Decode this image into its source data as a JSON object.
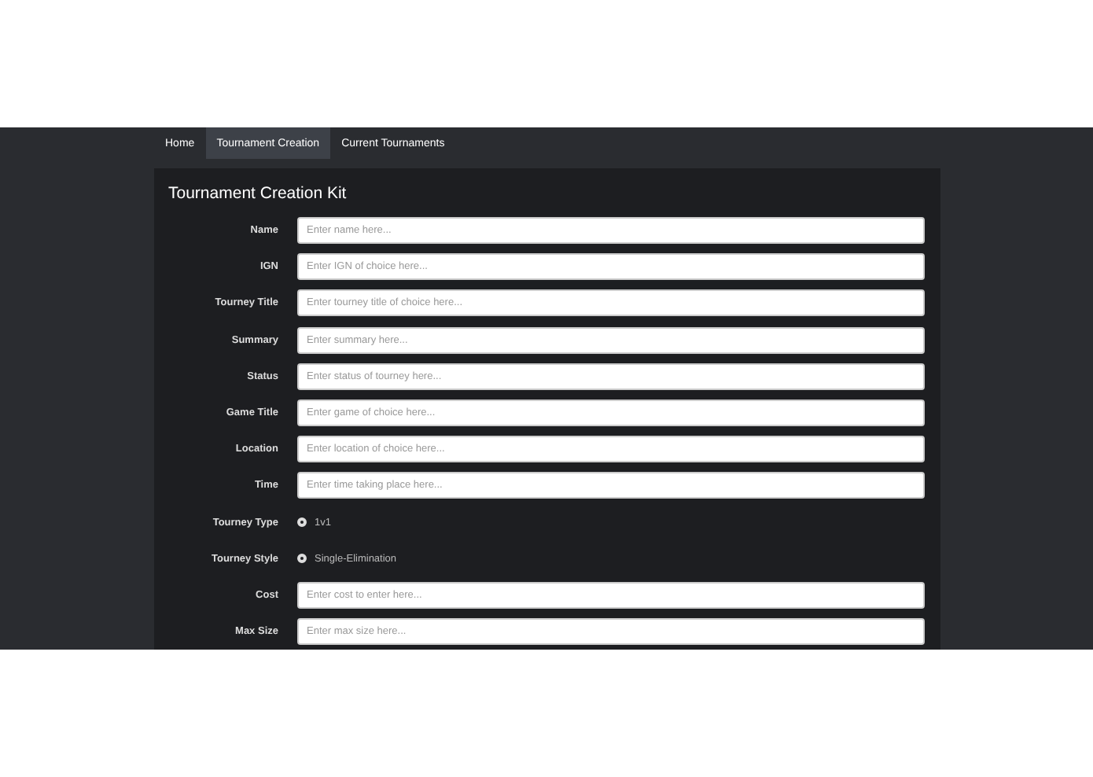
{
  "nav": {
    "items": [
      {
        "label": "Home",
        "selected": false
      },
      {
        "label": "Tournament Creation",
        "selected": true
      },
      {
        "label": "Current Tournaments",
        "selected": false
      }
    ]
  },
  "panel": {
    "title": "Tournament Creation Kit",
    "fields": [
      {
        "kind": "input",
        "label": "Name",
        "placeholder": "Enter name here..."
      },
      {
        "kind": "input",
        "label": "IGN",
        "placeholder": "Enter IGN of choice here..."
      },
      {
        "kind": "input",
        "label": "Tourney Title",
        "placeholder": "Enter tourney title of choice here..."
      },
      {
        "kind": "input",
        "label": "Summary",
        "placeholder": "Enter summary here..."
      },
      {
        "kind": "input",
        "label": "Status",
        "placeholder": "Enter status of tourney here..."
      },
      {
        "kind": "input",
        "label": "Game Title",
        "placeholder": "Enter game of choice here..."
      },
      {
        "kind": "input",
        "label": "Location",
        "placeholder": "Enter location of choice here..."
      },
      {
        "kind": "input",
        "label": "Time",
        "placeholder": "Enter time taking place here..."
      },
      {
        "kind": "radio",
        "label": "Tourney Type",
        "option": "1v1",
        "selected": true
      },
      {
        "kind": "radio",
        "label": "Tourney Style",
        "option": "Single-Elimination",
        "selected": true
      },
      {
        "kind": "input",
        "label": "Cost",
        "placeholder": "Enter cost to enter here..."
      },
      {
        "kind": "input",
        "label": "Max Size",
        "placeholder": "Enter max size here..."
      }
    ]
  }
}
